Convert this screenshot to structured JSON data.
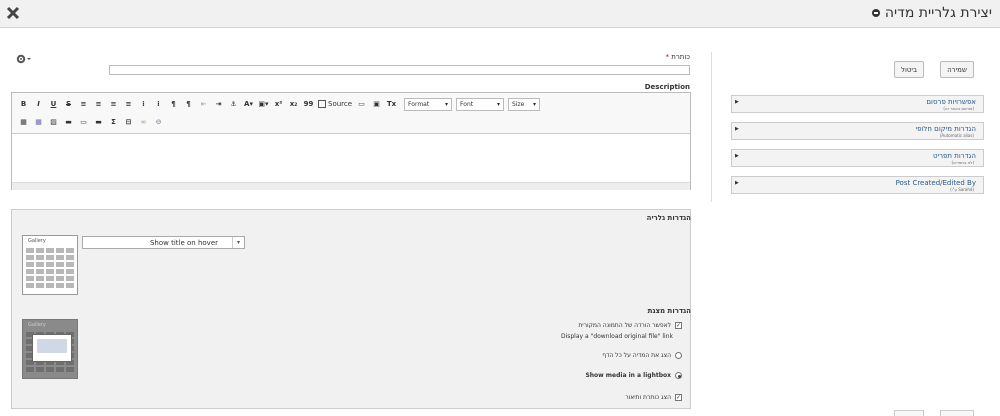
{
  "window": {
    "title": "יצירת גלריית מדיה"
  },
  "form": {
    "title_label": "כותרת",
    "title_required": "*",
    "title_value": "",
    "description_label": "Description"
  },
  "editor": {
    "toolbar_row1": [
      "B",
      "I",
      "U",
      "S",
      "≡",
      "≡",
      "≡",
      "≡",
      "⁝",
      "⁝",
      "¶",
      "¶",
      "⇤",
      "⇥",
      "⚓",
      "A",
      "A",
      "x²",
      "x₂",
      "99",
      "Source",
      "▭",
      "▣",
      "Tx"
    ],
    "source_label": "Source",
    "format_label": "Format",
    "font_label": "Font",
    "size_label": "Size",
    "toolbar_row2": [
      "table",
      "grid",
      "image",
      "media",
      "embed",
      "sigma",
      "frame",
      "link",
      "unlink"
    ]
  },
  "gallery": {
    "section_title": "הגדרות גלריה",
    "thumb_caption": "Gallery",
    "hover_select": "Show title on hover",
    "display_title": "הגדרות מצגת",
    "options": [
      {
        "type": "checkbox",
        "checked": true,
        "label": "לאפשר הורדה של התמונה המקורית",
        "sub": "Display a \"download original file\" link"
      },
      {
        "type": "radio",
        "checked": false,
        "label": "הצג את המדיה על כל הדף",
        "sub": ""
      },
      {
        "type": "radio",
        "checked": true,
        "label": "Show media in a lightbox",
        "sub": ""
      },
      {
        "type": "checkbox",
        "checked": true,
        "label": "הצג כותרת ותיאור",
        "sub": ""
      }
    ]
  },
  "sidebar": {
    "save_label": "שמירה",
    "cancel_label": "ביטול",
    "panels": [
      {
        "title": "אפשרויות פרסום",
        "sub": "(פורסם באתר זה)"
      },
      {
        "title": "הגדרות מיקום חלופי",
        "sub": "(Automatic alias)"
      },
      {
        "title": "הגדרות תפריט",
        "sub": "(לא בתפריט)"
      },
      {
        "title": "Post Created/Edited By",
        "sub": "(ע\"י Sarahd)"
      }
    ]
  },
  "colors": {
    "link": "#2a5a8c",
    "topbar": "#f1f1f1",
    "required": "#cc0000"
  }
}
